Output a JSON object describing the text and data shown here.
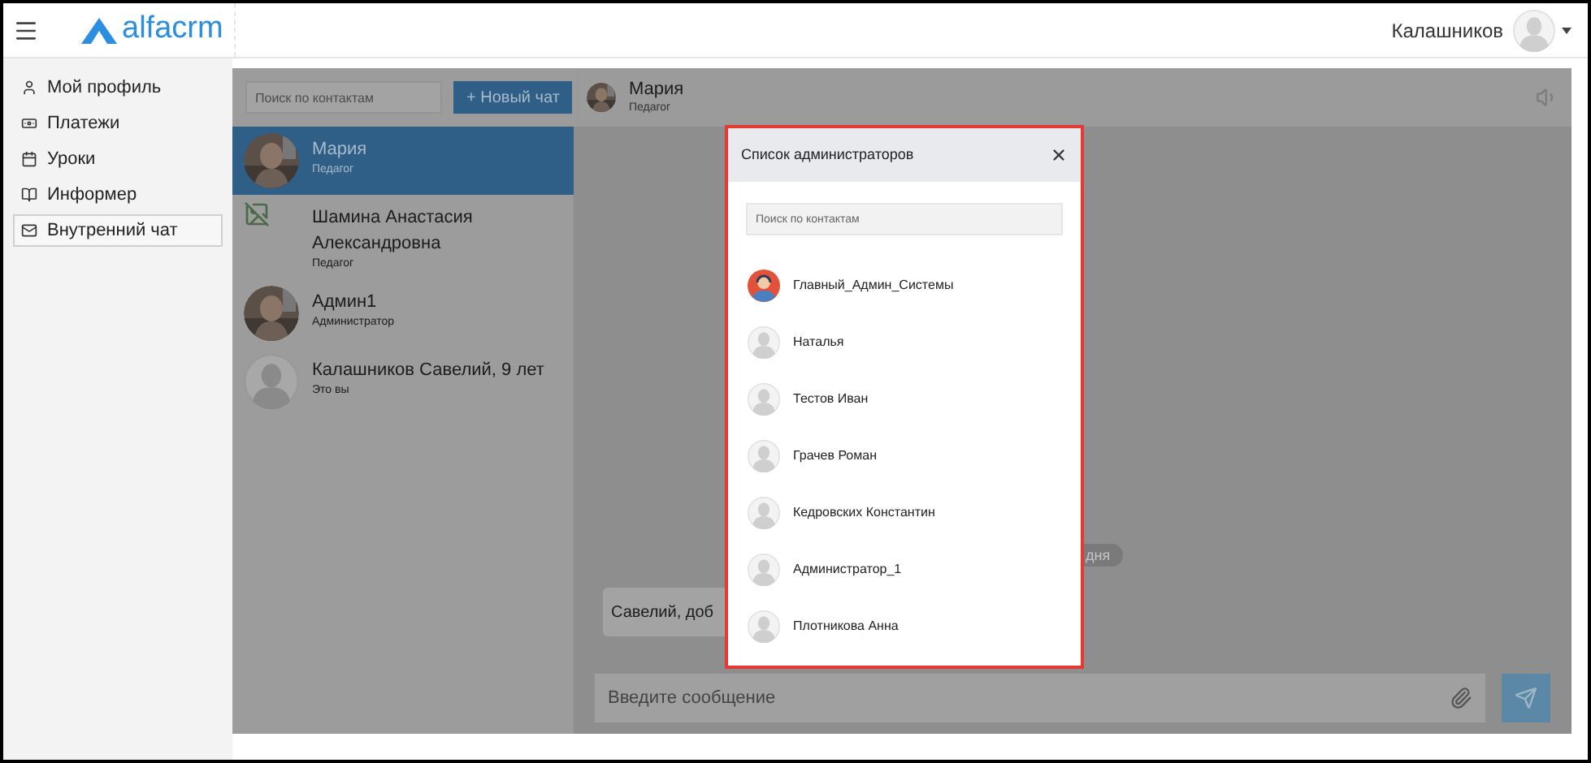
{
  "topbar": {
    "logo": "alfacrm",
    "user_name": "Калашников"
  },
  "sidebar": {
    "items": [
      {
        "label": "Мой профиль",
        "selected": false
      },
      {
        "label": "Платежи",
        "selected": false
      },
      {
        "label": "Уроки",
        "selected": false
      },
      {
        "label": "Информер",
        "selected": false
      },
      {
        "label": "Внутренний чат",
        "selected": true
      }
    ]
  },
  "contacts": {
    "search": {
      "placeholder": "Поиск по контактам"
    },
    "new_chat_button": "+ Новый чат",
    "items": [
      {
        "name": "Мария",
        "role": "Педагог",
        "selected": true
      },
      {
        "name": "Шамина Анастасия Александровна",
        "role": "Педагог",
        "kind": "broken",
        "selected": false
      },
      {
        "name": "Админ1",
        "role": "Администратор",
        "selected": false
      },
      {
        "name": "Калашников Савелий, 9 лет",
        "role": "Это вы",
        "kind": "default",
        "selected": false
      }
    ]
  },
  "chat": {
    "name": "Мария",
    "role": "Педагог",
    "date_label": "дня",
    "message": "Савелий, доб",
    "input": {
      "placeholder": "Введите сообщение"
    }
  },
  "modal": {
    "title": "Список администраторов",
    "search": {
      "placeholder": "Поиск по контактам"
    },
    "items": [
      {
        "name": "Главный_Админ_Системы",
        "kind": "custom"
      },
      {
        "name": "Наталья",
        "kind": "default"
      },
      {
        "name": "Тестов Иван",
        "kind": "default"
      },
      {
        "name": "Грачев Роман",
        "kind": "default"
      },
      {
        "name": "Кедровских Константин",
        "kind": "default"
      },
      {
        "name": "Администратор_1",
        "kind": "default"
      },
      {
        "name": "Плотникова Анна",
        "kind": "default"
      }
    ]
  }
}
